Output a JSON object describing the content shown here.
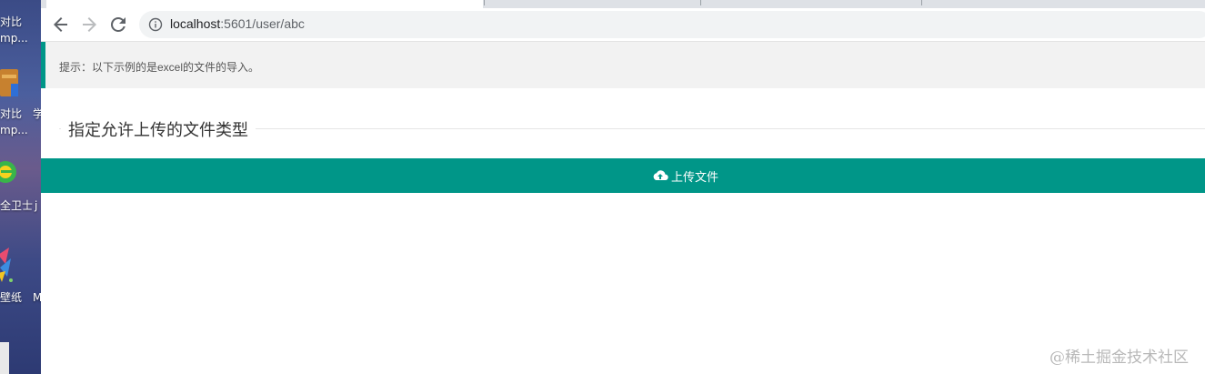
{
  "desktop": {
    "labels": [
      "对比",
      "mp...",
      "对比",
      "mp...",
      "学",
      "全卫士",
      "j",
      "壁纸",
      "M"
    ]
  },
  "browser": {
    "url_host": "localhost",
    "url_path": ":5601/user/abc"
  },
  "page": {
    "tip": "提示：以下示例的是excel的文件的导入。",
    "legend": "指定允许上传的文件类型",
    "upload_button": "上传文件",
    "watermark": "@稀土掘金技术社区"
  },
  "colors": {
    "accent": "#009688"
  }
}
